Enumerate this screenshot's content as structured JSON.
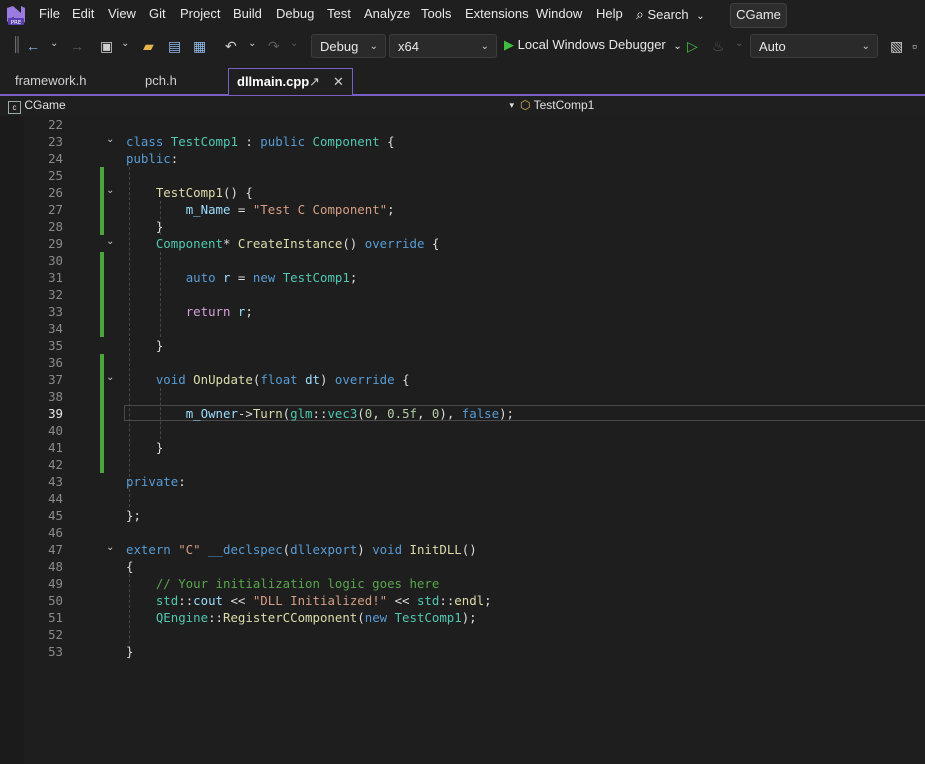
{
  "menu": {
    "items": [
      "File",
      "Edit",
      "View",
      "Git",
      "Project",
      "Build",
      "Debug",
      "Test",
      "Analyze",
      "Tools",
      "Extensions",
      "Window",
      "Help"
    ],
    "search_label": "Search",
    "solution_name": "CGame"
  },
  "toolbar": {
    "configuration": "Debug",
    "platform": "x64",
    "run_label": "Local Windows Debugger",
    "auto_label": "Auto"
  },
  "tabs": [
    {
      "label": "framework.h"
    },
    {
      "label": "pch.h"
    },
    {
      "label": "dllmain.cpp",
      "active": true
    }
  ],
  "navbar": {
    "project": "CGame",
    "scope": "TestComp1"
  },
  "editor": {
    "current_line": 39,
    "lines": [
      {
        "n": 22,
        "t": []
      },
      {
        "n": 23,
        "t": [
          [
            "kw",
            "class "
          ],
          [
            "type",
            "TestComp1"
          ],
          [
            "pl",
            " : "
          ],
          [
            "kw",
            "public "
          ],
          [
            "type",
            "Component"
          ],
          [
            "pl",
            " {"
          ]
        ]
      },
      {
        "n": 24,
        "t": [
          [
            "kw",
            "public"
          ],
          [
            "pl",
            ":"
          ]
        ]
      },
      {
        "n": 25,
        "t": []
      },
      {
        "n": 26,
        "t": [
          [
            "pl",
            "    "
          ],
          [
            "fn",
            "TestComp1"
          ],
          [
            "pl",
            "() {"
          ]
        ]
      },
      {
        "n": 27,
        "t": [
          [
            "pl",
            "        "
          ],
          [
            "var",
            "m_Name"
          ],
          [
            "pl",
            " = "
          ],
          [
            "str",
            "\"Test C Component\""
          ],
          [
            "pl",
            ";"
          ]
        ]
      },
      {
        "n": 28,
        "t": [
          [
            "pl",
            "    }"
          ]
        ]
      },
      {
        "n": 29,
        "t": [
          [
            "pl",
            "    "
          ],
          [
            "type",
            "Component"
          ],
          [
            "pl",
            "* "
          ],
          [
            "fn",
            "CreateInstance"
          ],
          [
            "pl",
            "() "
          ],
          [
            "kw",
            "override"
          ],
          [
            "pl",
            " {"
          ]
        ]
      },
      {
        "n": 30,
        "t": []
      },
      {
        "n": 31,
        "t": [
          [
            "pl",
            "        "
          ],
          [
            "kw",
            "auto "
          ],
          [
            "var",
            "r"
          ],
          [
            "pl",
            " = "
          ],
          [
            "kw",
            "new "
          ],
          [
            "type",
            "TestComp1"
          ],
          [
            "pl",
            ";"
          ]
        ]
      },
      {
        "n": 32,
        "t": []
      },
      {
        "n": 33,
        "t": [
          [
            "pl",
            "        "
          ],
          [
            "ctl",
            "return "
          ],
          [
            "var",
            "r"
          ],
          [
            "pl",
            ";"
          ]
        ]
      },
      {
        "n": 34,
        "t": []
      },
      {
        "n": 35,
        "t": [
          [
            "pl",
            "    }"
          ]
        ]
      },
      {
        "n": 36,
        "t": []
      },
      {
        "n": 37,
        "t": [
          [
            "pl",
            "    "
          ],
          [
            "kw",
            "void "
          ],
          [
            "fn",
            "OnUpdate"
          ],
          [
            "pl",
            "("
          ],
          [
            "kw",
            "float "
          ],
          [
            "var",
            "dt"
          ],
          [
            "pl",
            ") "
          ],
          [
            "kw",
            "override"
          ],
          [
            "pl",
            " {"
          ]
        ]
      },
      {
        "n": 38,
        "t": []
      },
      {
        "n": 39,
        "t": [
          [
            "pl",
            "        "
          ],
          [
            "var",
            "m_Owner"
          ],
          [
            "pl",
            "->"
          ],
          [
            "fn",
            "Turn"
          ],
          [
            "pl",
            "("
          ],
          [
            "type",
            "glm"
          ],
          [
            "pl",
            "::"
          ],
          [
            "type",
            "vec3"
          ],
          [
            "pl",
            "("
          ],
          [
            "num",
            "0"
          ],
          [
            "pl",
            ", "
          ],
          [
            "num",
            "0.5f"
          ],
          [
            "pl",
            ", "
          ],
          [
            "num",
            "0"
          ],
          [
            "pl",
            "), "
          ],
          [
            "kw",
            "false"
          ],
          [
            "pl",
            ");"
          ]
        ]
      },
      {
        "n": 40,
        "t": []
      },
      {
        "n": 41,
        "t": [
          [
            "pl",
            "    }"
          ]
        ]
      },
      {
        "n": 42,
        "t": []
      },
      {
        "n": 43,
        "t": [
          [
            "kw",
            "private"
          ],
          [
            "pl",
            ":"
          ]
        ]
      },
      {
        "n": 44,
        "t": []
      },
      {
        "n": 45,
        "t": [
          [
            "pl",
            "};"
          ]
        ]
      },
      {
        "n": 46,
        "t": []
      },
      {
        "n": 47,
        "t": [
          [
            "kw",
            "extern "
          ],
          [
            "str",
            "\"C\" "
          ],
          [
            "kw",
            "__declspec"
          ],
          [
            "pl",
            "("
          ],
          [
            "kw",
            "dllexport"
          ],
          [
            "pl",
            ") "
          ],
          [
            "kw",
            "void "
          ],
          [
            "fn",
            "InitDLL"
          ],
          [
            "pl",
            "()"
          ]
        ]
      },
      {
        "n": 48,
        "t": [
          [
            "pl",
            "{"
          ]
        ]
      },
      {
        "n": 49,
        "t": [
          [
            "pl",
            "    "
          ],
          [
            "com",
            "// Your initialization logic goes here"
          ]
        ]
      },
      {
        "n": 50,
        "t": [
          [
            "pl",
            "    "
          ],
          [
            "type",
            "std"
          ],
          [
            "pl",
            "::"
          ],
          [
            "var",
            "cout"
          ],
          [
            "pl",
            " << "
          ],
          [
            "str",
            "\"DLL Initialized!\""
          ],
          [
            "pl",
            " << "
          ],
          [
            "type",
            "std"
          ],
          [
            "pl",
            "::"
          ],
          [
            "fn",
            "endl"
          ],
          [
            "pl",
            ";"
          ]
        ]
      },
      {
        "n": 51,
        "t": [
          [
            "pl",
            "    "
          ],
          [
            "type",
            "QEngine"
          ],
          [
            "pl",
            "::"
          ],
          [
            "fn",
            "RegisterCComponent"
          ],
          [
            "pl",
            "("
          ],
          [
            "kw",
            "new "
          ],
          [
            "type",
            "TestComp1"
          ],
          [
            "pl",
            ");"
          ]
        ]
      },
      {
        "n": 52,
        "t": []
      },
      {
        "n": 53,
        "t": [
          [
            "pl",
            "}"
          ]
        ]
      }
    ]
  }
}
